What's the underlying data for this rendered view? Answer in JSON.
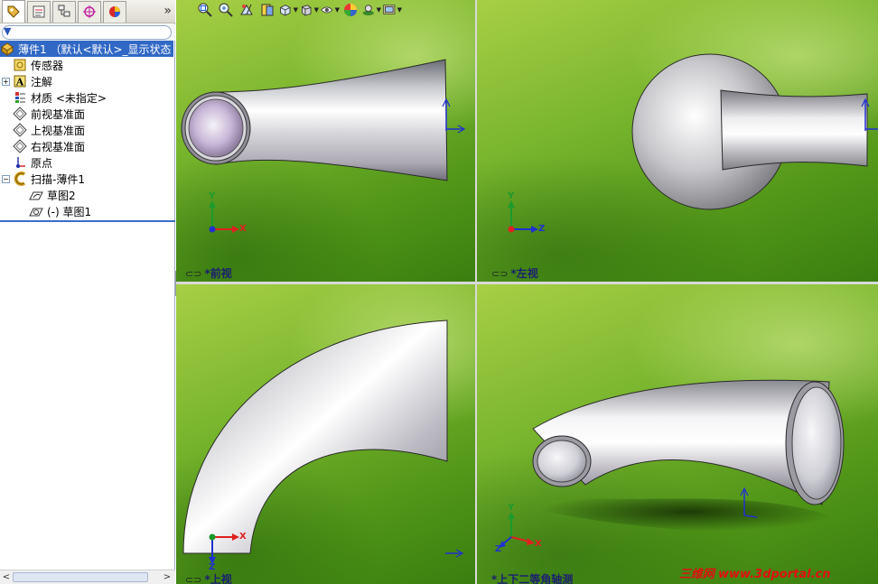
{
  "feature_tree": {
    "root": {
      "label": "薄件1  （默认<默认>_显示状态"
    },
    "items": [
      {
        "label": "传感器"
      },
      {
        "label": "注解"
      },
      {
        "label": "材质 <未指定>"
      },
      {
        "label": "前视基准面"
      },
      {
        "label": "上视基准面"
      },
      {
        "label": "右视基准面"
      },
      {
        "label": "原点"
      },
      {
        "label": "扫描-薄件1"
      },
      {
        "label": "草图2"
      },
      {
        "label": "(-) 草图1"
      }
    ]
  },
  "viewports": [
    {
      "label": "*前视"
    },
    {
      "label": "*左视"
    },
    {
      "label": "*上视"
    },
    {
      "label": "*上下二等角轴测"
    }
  ],
  "axes": {
    "x": "X",
    "y": "Y",
    "z": "Z"
  },
  "axis_colors": {
    "x": "#e02020",
    "y": "#1c9a2c",
    "z": "#2030d0"
  },
  "panel_tabs": [
    "feature-manager-icon",
    "property-manager-icon",
    "configuration-manager-icon",
    "dimxpert-icon",
    "display-manager-icon"
  ],
  "panel_tab_more": "»",
  "scroll": {
    "left": "<",
    "right": ">"
  },
  "collapse_glyph": "◂",
  "toolbar_icons": [
    "zoom-to-fit-icon",
    "zoom-area-icon",
    "previous-view-icon",
    "section-view-icon",
    "view-orientation-icon",
    "display-style-icon",
    "hide-show-icon",
    "edit-appearance-icon",
    "apply-scene-icon",
    "view-settings-icon"
  ],
  "watermark": {
    "cn": "三维网",
    "url": "www.3dportal.cn"
  }
}
